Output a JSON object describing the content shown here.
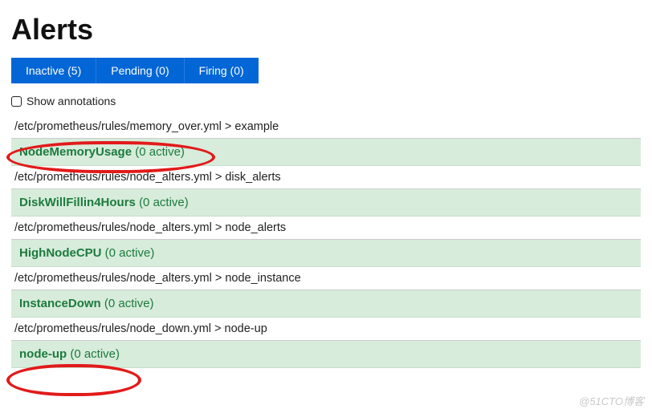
{
  "title": "Alerts",
  "tabs": {
    "inactive": "Inactive (5)",
    "pending": "Pending (0)",
    "firing": "Firing (0)"
  },
  "show_annotations_label": "Show annotations",
  "groups": [
    {
      "header": "/etc/prometheus/rules/memory_over.yml > example",
      "alert_name": "NodeMemoryUsage",
      "alert_active": "(0 active)"
    },
    {
      "header": "/etc/prometheus/rules/node_alters.yml > disk_alerts",
      "alert_name": "DiskWillFillin4Hours",
      "alert_active": "(0 active)"
    },
    {
      "header": "/etc/prometheus/rules/node_alters.yml > node_alerts",
      "alert_name": "HighNodeCPU",
      "alert_active": "(0 active)"
    },
    {
      "header": "/etc/prometheus/rules/node_alters.yml > node_instance",
      "alert_name": "InstanceDown",
      "alert_active": "(0 active)"
    },
    {
      "header": "/etc/prometheus/rules/node_down.yml > node-up",
      "alert_name": "node-up",
      "alert_active": "(0 active)"
    }
  ],
  "watermark": "@51CTO博客"
}
